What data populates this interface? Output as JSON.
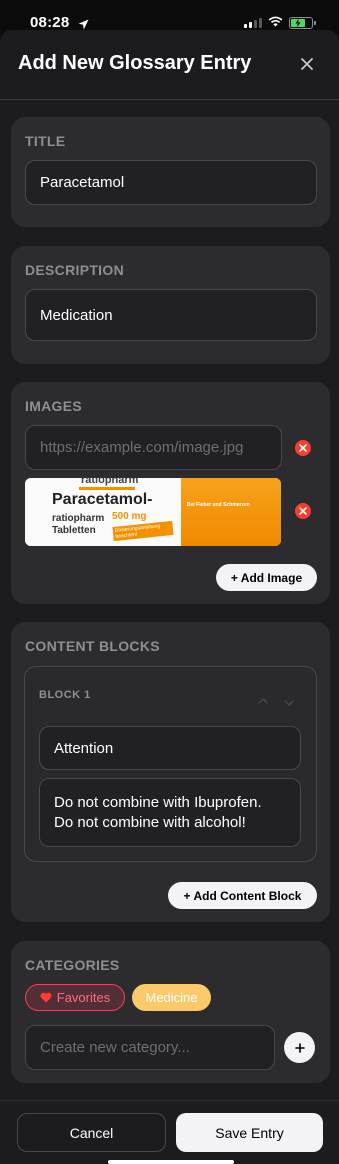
{
  "status_bar": {
    "time": "08:28"
  },
  "header": {
    "title": "Add New Glossary Entry",
    "close_icon": "close-icon"
  },
  "title_section": {
    "label": "TITLE",
    "value": "Paracetamol"
  },
  "description_section": {
    "label": "DESCRIPTION",
    "value": "Medication"
  },
  "images_section": {
    "label": "IMAGES",
    "url_placeholder": "https://example.com/image.jpg",
    "image_logo": "ratiopharm",
    "image_product_name": "Paracetamol-",
    "image_brand": "ratiopharm",
    "image_dose": "500 mg",
    "image_form": "Tabletten",
    "image_note": "Dosierungsanleitung beachten!",
    "image_banner": "Bei Fieber und Schmerzen",
    "add_button": "+ Add Image"
  },
  "content_blocks_section": {
    "label": "CONTENT BLOCKS",
    "blocks": [
      {
        "label": "BLOCK 1",
        "title": "Attention",
        "body": "Do not combine with Ibuprofen.\nDo not combine with alcohol!"
      }
    ],
    "add_button": "+ Add Content Block"
  },
  "categories_section": {
    "label": "CATEGORIES",
    "chips": [
      {
        "icon": "heart-icon",
        "label": "Favorites",
        "color": "#ff3b5c"
      },
      {
        "label": "Medicine",
        "color": "#fbc96a"
      }
    ],
    "new_placeholder": "Create new category..."
  },
  "footer": {
    "cancel": "Cancel",
    "save": "Save Entry"
  }
}
